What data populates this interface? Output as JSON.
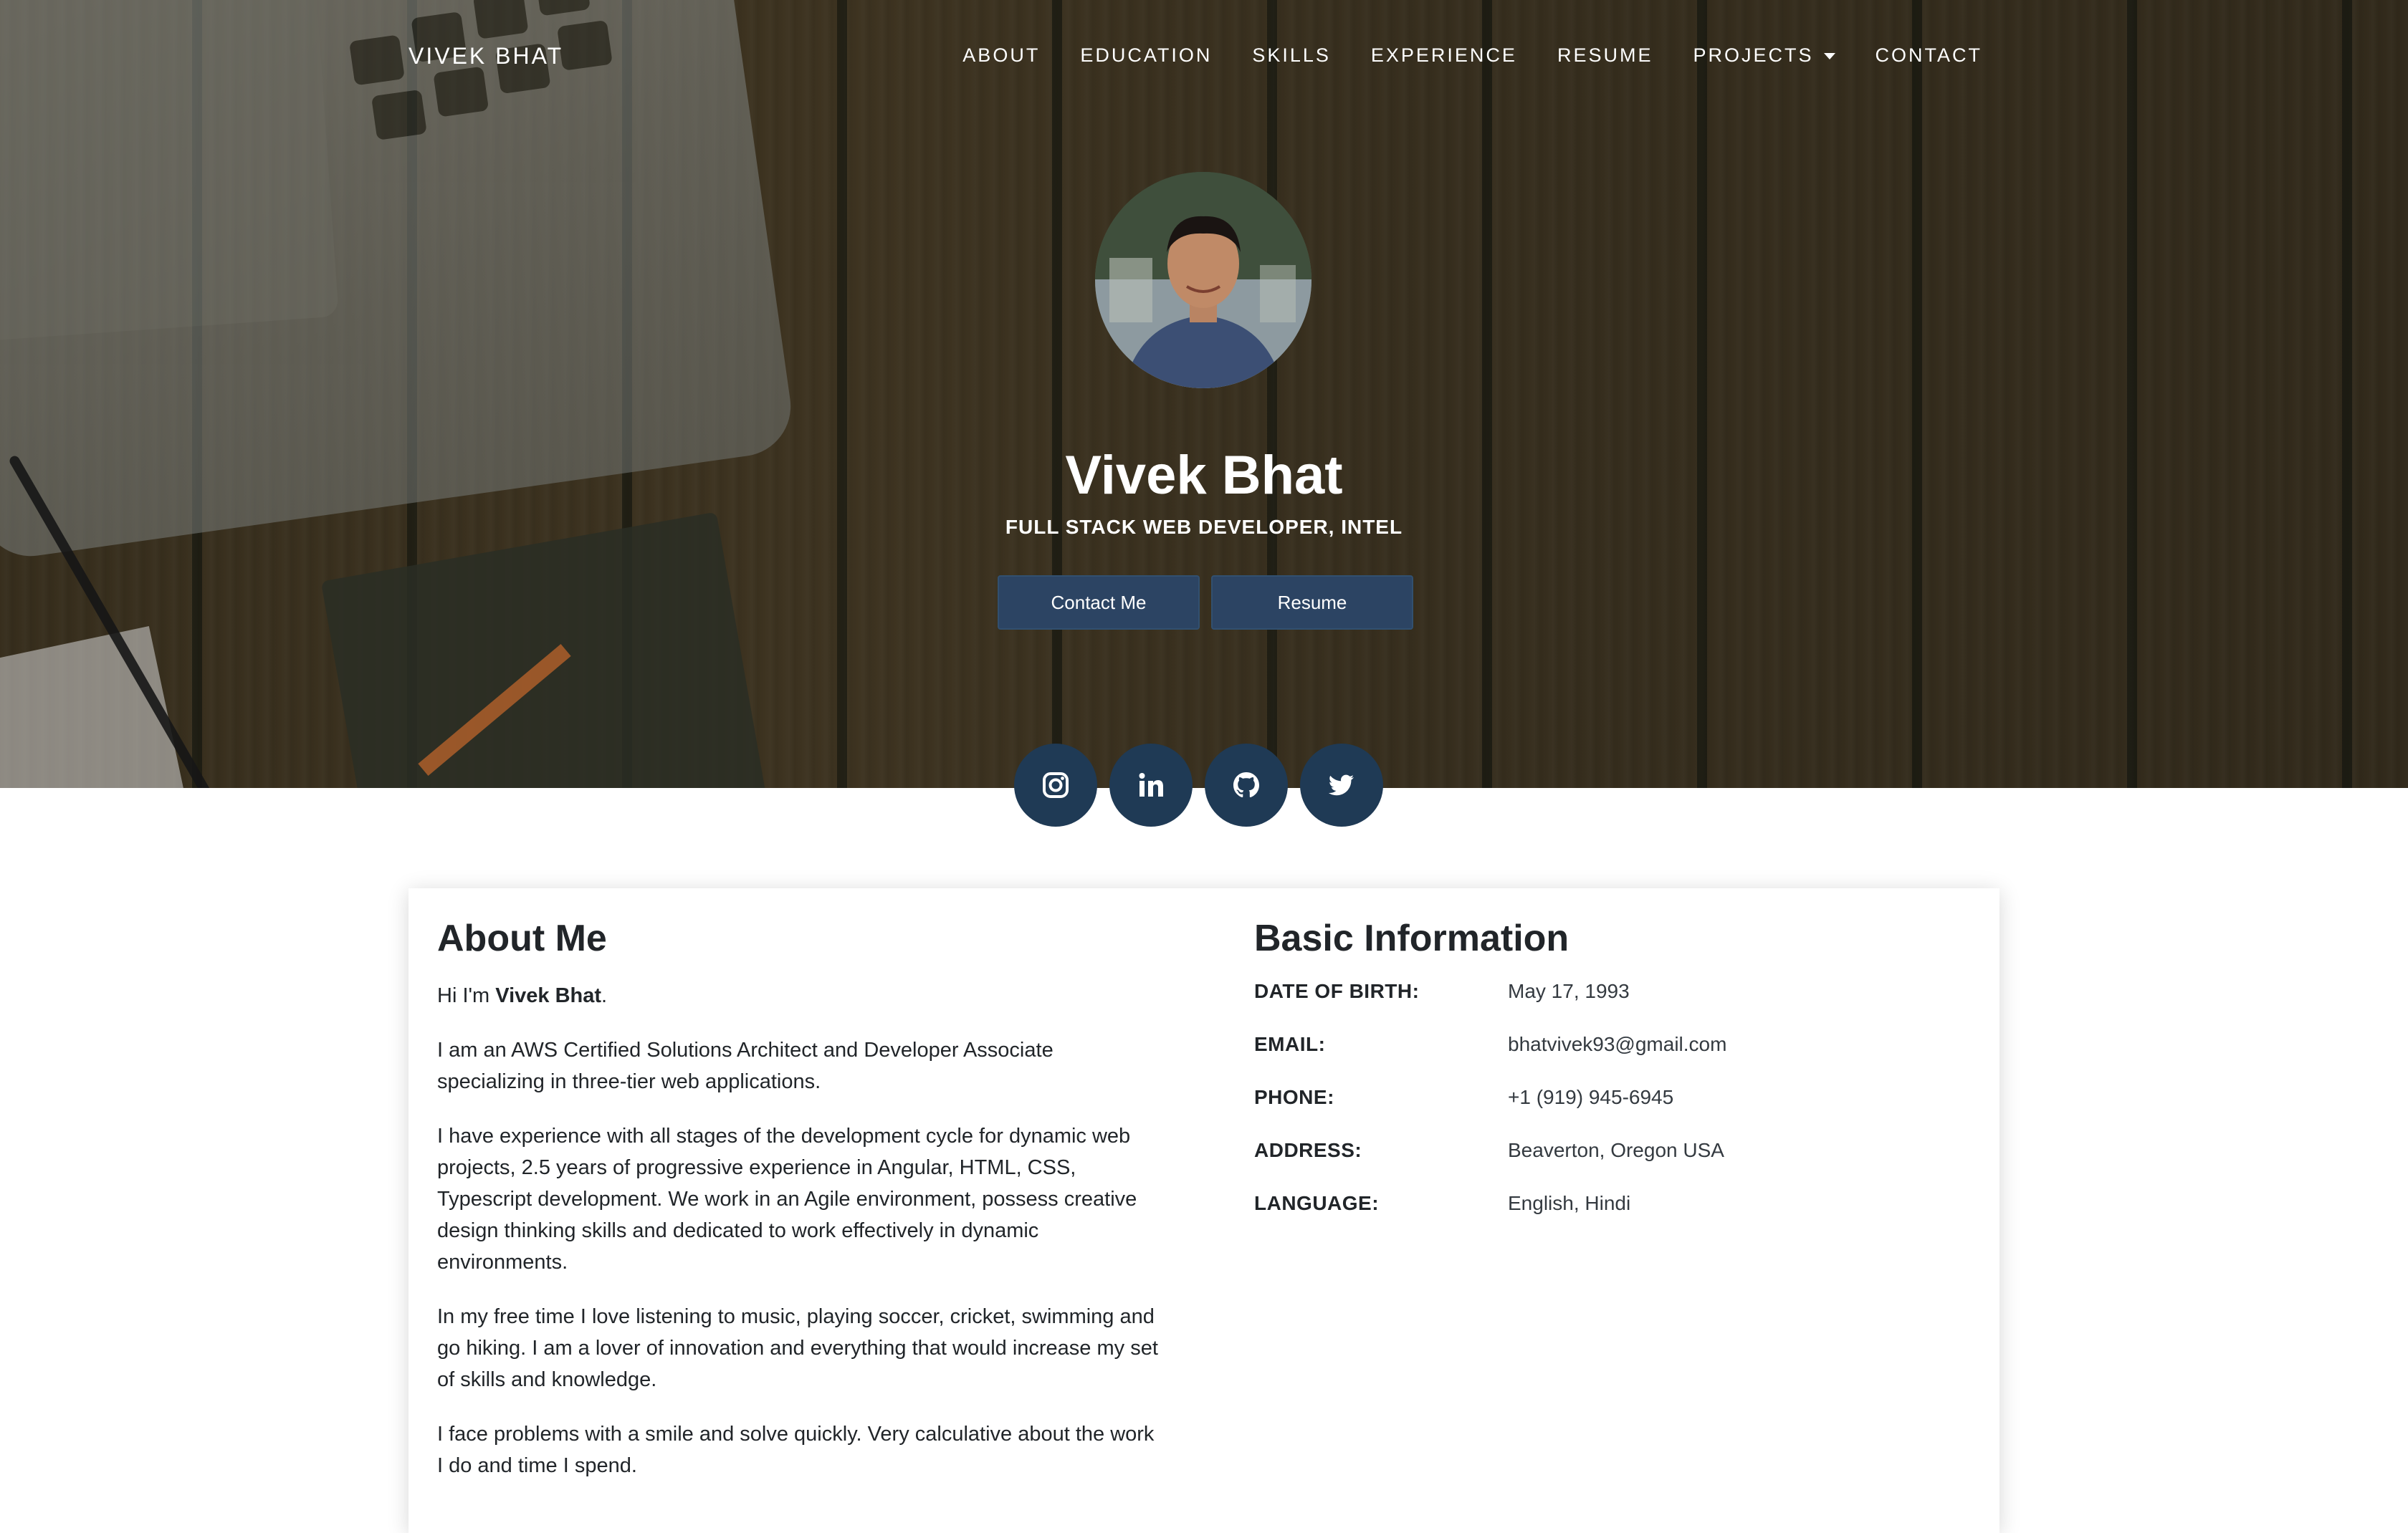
{
  "nav": {
    "brand": "VIVEK BHAT",
    "links": [
      {
        "label": "ABOUT"
      },
      {
        "label": "EDUCATION"
      },
      {
        "label": "SKILLS"
      },
      {
        "label": "EXPERIENCE"
      },
      {
        "label": "RESUME"
      },
      {
        "label": "PROJECTS",
        "has_dropdown": true
      },
      {
        "label": "CONTACT"
      }
    ]
  },
  "hero": {
    "name": "Vivek Bhat",
    "title": "FULL STACK WEB DEVELOPER, INTEL",
    "buttons": {
      "contact": "Contact Me",
      "resume": "Resume"
    },
    "button_color": "#2c4463"
  },
  "social": [
    {
      "icon": "instagram-icon"
    },
    {
      "icon": "linkedin-icon"
    },
    {
      "icon": "github-icon"
    },
    {
      "icon": "twitter-icon"
    }
  ],
  "about": {
    "heading": "About Me",
    "greeting_prefix": "Hi I'm ",
    "greeting_name": "Vivek Bhat",
    "greeting_suffix": ".",
    "paragraphs": [
      "I am an AWS Certified Solutions Architect and Developer Associate specializing in three-tier web applications.",
      "I have experience with all stages of the development cycle for dynamic web projects, 2.5 years of progressive experience in Angular, HTML, CSS, Typescript development. We work in an Agile environment, possess creative design thinking skills and dedicated to work effectively in dynamic environments.",
      "In my free time I love listening to music, playing soccer, cricket, swimming and go hiking. I am a lover of innovation and everything that would increase my set of skills and knowledge.",
      "I face problems with a smile and solve quickly. Very calculative about the work I do and time I spend."
    ]
  },
  "basic_info": {
    "heading": "Basic Information",
    "rows": [
      {
        "label": "DATE OF BIRTH:",
        "value": "May 17, 1993"
      },
      {
        "label": "EMAIL:",
        "value": "bhatvivek93@gmail.com"
      },
      {
        "label": "PHONE:",
        "value": "+1 (919) 945-6945"
      },
      {
        "label": "ADDRESS:",
        "value": "Beaverton, Oregon USA"
      },
      {
        "label": "LANGUAGE:",
        "value": "English, Hindi"
      }
    ]
  }
}
